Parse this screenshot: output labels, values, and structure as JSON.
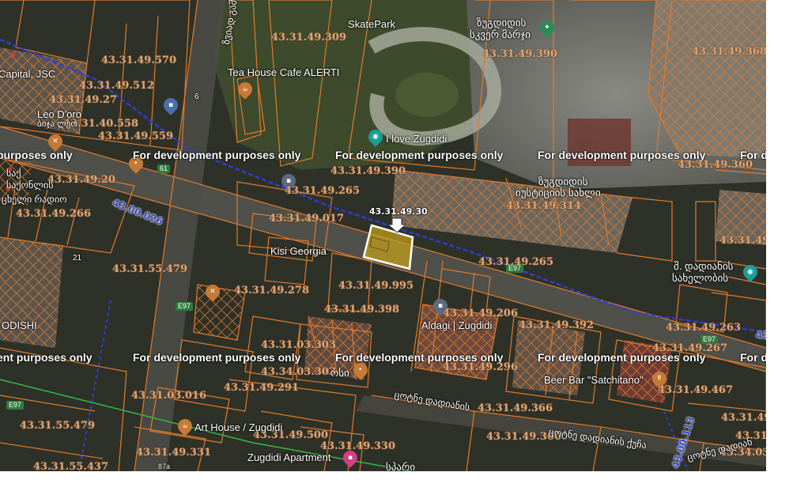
{
  "colors": {
    "parcel_line": "#e07b2c",
    "parcel_label": "#d9a77a",
    "selected_outline": "#ffffff",
    "selected_fill": "#c9a419",
    "blue_line": "#2f3fd8",
    "green_line": "#35b84a",
    "pin_orange": "#c77a35",
    "pin_teal": "#1b9e9a",
    "pin_green": "#2e8b57"
  },
  "watermark": "For development purposes only",
  "watermark_partial_right": "For d",
  "watermark_partial_left": "ent purposes only",
  "watermark_partial_left_top": "purposes only",
  "selected_parcel": {
    "label": "43.31.49.30",
    "arrow_icon": "down-arrow-icon"
  },
  "parcel_labels": [
    "43.31.49.309",
    "43.31.49.390",
    "43.31.49.368",
    "43.31.49.570",
    "43.31.49.512",
    "43.31.49.27",
    "43.31.40.558",
    "43.31.49.559",
    "43.31.49.360",
    "43.31.49.390",
    "43.31.49.265",
    "43.31.49.314",
    "43.31.49.20",
    "43.31.49.017",
    "43.31.49.266",
    "43.31.55.479",
    "43.31.49.265",
    "43.31.49.995",
    "43.31.49.278",
    "43.31.49.398",
    "43.31.49.206",
    "43.31.49.392",
    "43.31.49.263",
    "43.31.03.303",
    "43.31.49.267",
    "43.31.49.296",
    "43.34.03.303",
    "43.31.49.291",
    "43.31.03.016",
    "43.31.49.467",
    "43.31.49.366",
    "43.31.55.479",
    "43.31.49.500",
    "43.31.49.331",
    "43.31.49.330",
    "43.31.49.360",
    "43.31.55.437",
    "43.31.49.305",
    "43.34.03",
    "43.31.49.367",
    "43.31.49"
  ],
  "blue_labels": [
    "43.00.026",
    "43.00.113",
    "43"
  ],
  "poi_labels": {
    "skatepark": "SkatePark",
    "zugdidi_museum_1": "ზუგდიდის",
    "zugdidi_museum_2": "სკვერ მარჯი",
    "tea_house": "Tea House Cafe ALERTI",
    "capital": "Capital, JSC",
    "leo_doro": "Leo D'oro",
    "leo_doro_sub": "ბიჯა ლეო",
    "i_love_zugdidi": "I love Zugdidi",
    "zugdidi_justice_1": "ზუგდიდის",
    "zugdidi_justice_2": "იუსტიციის სახლი",
    "left_geo_1": "საქ",
    "left_geo_2": "საქონლის",
    "left_geo_3": "ცხელი რადიო",
    "georgia": "Kisi Georgia",
    "aldagi": "Aldagi | Zugdidi",
    "right_geo_1": "შ. დადიანის",
    "right_geo_2": "სახელობის",
    "beer_bar": "Beer Bar \"Satchitano\"",
    "art_house": "Art House / Zugdidi",
    "zugdidi_apartment": "Zugdidi Apartment",
    "odishi": "ODISHI",
    "bottom_geo": "სპარი",
    "mid_geo": "ოსი"
  },
  "road_labels": {
    "vertical_road": "ზვიად გამსახ",
    "road_bottom_1": "ცოტნე დადიანის",
    "road_bottom_2": "ცოტნე დადიანის ქუჩა",
    "road_bottom_3": "ცოტნე დადიან",
    "e97_a": "E97",
    "e97_b": "E97",
    "e97_c": "E97",
    "e97_d": "E97",
    "shield_61": "61",
    "num_21": "21",
    "num_6": "6",
    "num_87": "87a"
  }
}
